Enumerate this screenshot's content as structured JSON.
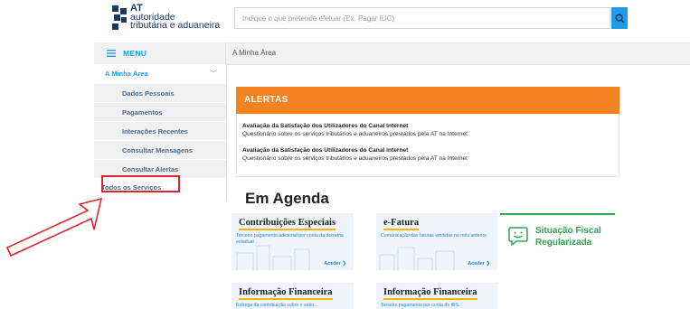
{
  "header": {
    "logo": {
      "line1": "AT",
      "line2": "autoridade",
      "line3": "tributária e aduaneira"
    },
    "search": {
      "placeholder": "Indique o que pretende efetuar (Ex. Pagar IUC)",
      "icon": "search-icon"
    }
  },
  "topbar": {
    "menu_label": "MENU",
    "breadcrumb": "A Minha Área"
  },
  "sidebar": {
    "section": "A Minha Área",
    "items": [
      {
        "label": "Dados Pessoais"
      },
      {
        "label": "Pagamentos"
      },
      {
        "label": "Interações Recentes"
      },
      {
        "label": "Consultar Mensagens"
      },
      {
        "label": "Consultar Alertas"
      }
    ],
    "last": "Todos os Serviços"
  },
  "alerts": {
    "title": "ALERTAS",
    "entries": [
      {
        "title": "Avaliação da Satisfação dos Utilizadores do Canal Internet",
        "text": "Questionário sobre os serviços tributários e aduaneiros prestados pela AT na Internet"
      },
      {
        "title": "Avaliação da Satisfação dos Utilizadores do Canal Internet",
        "text": "Questionário sobre os serviços tributários e aduaneiros prestados pela AT na Internet"
      }
    ]
  },
  "agenda": {
    "title": "Em Agenda",
    "cards": [
      {
        "title": "Contribuições Especiais",
        "desc": "Terceiro pagamento adicional por conta da derrama estadual",
        "action": "Aceder ❯"
      },
      {
        "title": "e-Fatura",
        "desc": "Comunicação das faturas emitidas no mês anterior.",
        "action": "Aceder ❯"
      },
      {
        "title": "Informação Financeira",
        "desc": "Entrega da contribuição sobre o setor...",
        "action": ""
      },
      {
        "title": "Informação Financeira",
        "desc": "Terceiro pagamento por conta do IRS.",
        "action": ""
      }
    ],
    "status": {
      "line1": "Situação Fiscal",
      "line2": "Regularizada"
    }
  },
  "colors": {
    "accent": "#1e9be6",
    "alert": "#f58220",
    "highlight": "#d9272e",
    "ok": "#2ea44f"
  }
}
